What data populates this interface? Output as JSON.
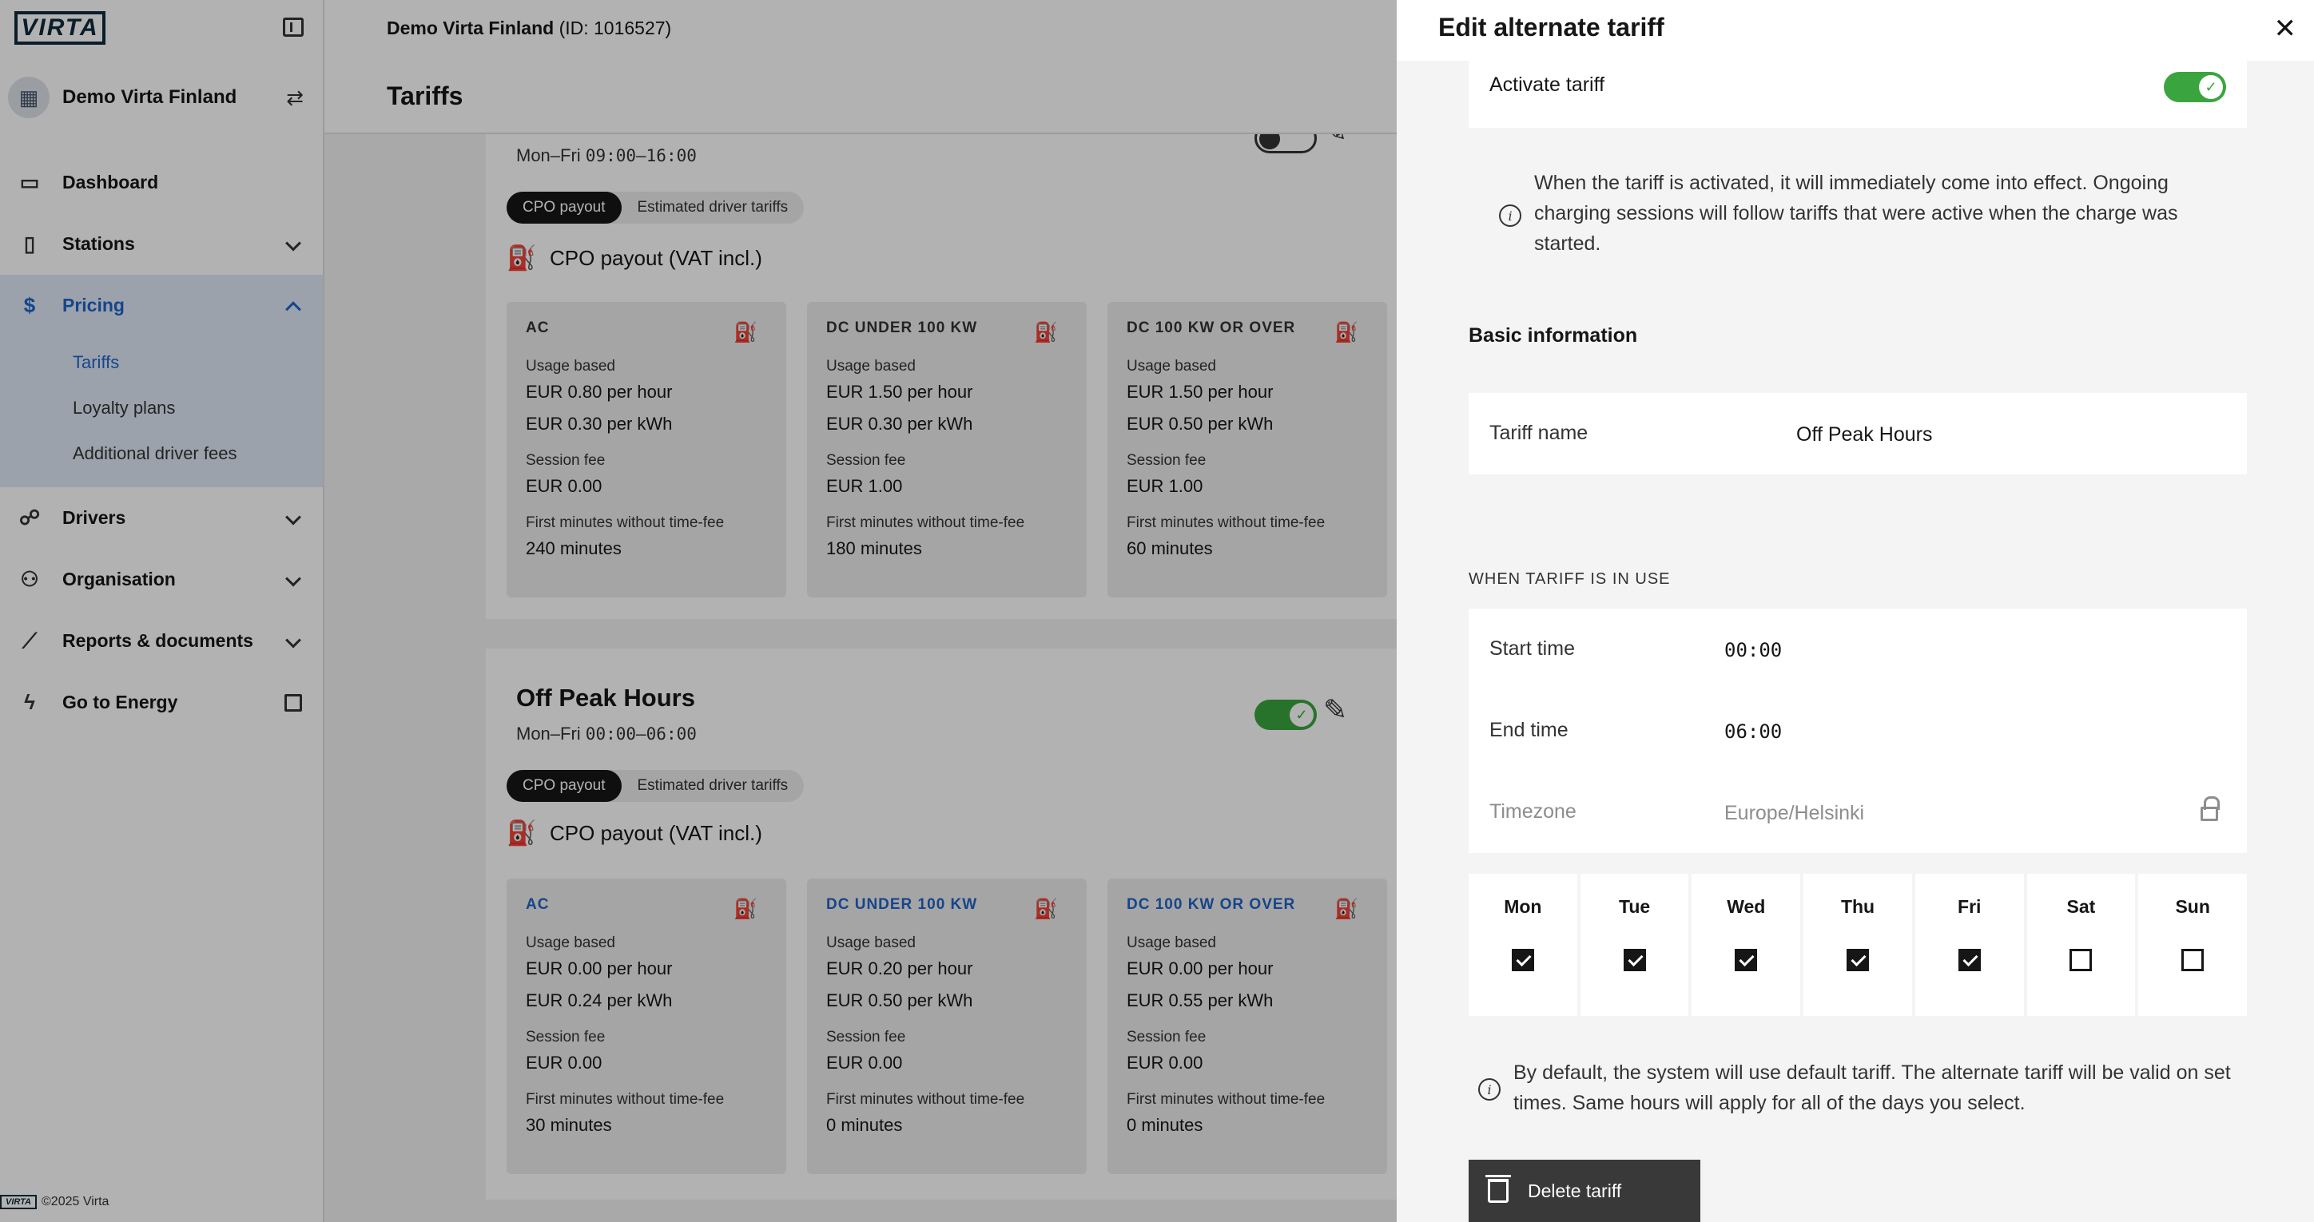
{
  "sidebar": {
    "logo": "VIRTA",
    "org_name": "Demo Virta Finland",
    "nav": [
      {
        "label": "Dashboard"
      },
      {
        "label": "Stations"
      },
      {
        "label": "Pricing"
      },
      {
        "label": "Drivers"
      },
      {
        "label": "Organisation"
      },
      {
        "label": "Reports & documents"
      },
      {
        "label": "Go to Energy"
      }
    ],
    "pricing_sub": [
      {
        "label": "Tariffs"
      },
      {
        "label": "Loyalty plans"
      },
      {
        "label": "Additional driver fees"
      }
    ],
    "footer": "©2025 Virta"
  },
  "header": {
    "org_name": "Demo Virta Finland",
    "org_id": "(ID: 1016527)",
    "page_title": "Tariffs"
  },
  "tariffs": [
    {
      "name": "",
      "days": "Mon–Fri ",
      "hours": "09:00–16:00",
      "active": false,
      "chips": [
        "CPO payout",
        "Estimated driver tariffs"
      ],
      "section_title": "CPO payout (VAT incl.)",
      "connectors": [
        {
          "title": "AC",
          "usage_label": "Usage based",
          "rate_hour": "EUR 0.80 per hour",
          "rate_kwh": "EUR 0.30 per kWh",
          "session_label": "Session fee",
          "session_fee": "EUR 0.00",
          "free_label": "First minutes without time-fee",
          "free_minutes": "240 minutes"
        },
        {
          "title": "DC UNDER 100 KW",
          "usage_label": "Usage based",
          "rate_hour": "EUR 1.50 per hour",
          "rate_kwh": "EUR 0.30 per kWh",
          "session_label": "Session fee",
          "session_fee": "EUR 1.00",
          "free_label": "First minutes without time-fee",
          "free_minutes": "180 minutes"
        },
        {
          "title": "DC 100 KW OR OVER",
          "usage_label": "Usage based",
          "rate_hour": "EUR 1.50 per hour",
          "rate_kwh": "EUR 0.50 per kWh",
          "session_label": "Session fee",
          "session_fee": "EUR 1.00",
          "free_label": "First minutes without time-fee",
          "free_minutes": "60 minutes"
        }
      ]
    },
    {
      "name": "Off Peak Hours",
      "days": "Mon–Fri ",
      "hours": "00:00–06:00",
      "active": true,
      "chips": [
        "CPO payout",
        "Estimated driver tariffs"
      ],
      "section_title": "CPO payout (VAT incl.)",
      "connectors": [
        {
          "title": "AC",
          "usage_label": "Usage based",
          "rate_hour": "EUR 0.00 per hour",
          "rate_kwh": "EUR 0.24 per kWh",
          "session_label": "Session fee",
          "session_fee": "EUR 0.00",
          "free_label": "First minutes without time-fee",
          "free_minutes": "30 minutes"
        },
        {
          "title": "DC UNDER 100 KW",
          "usage_label": "Usage based",
          "rate_hour": "EUR 0.20 per hour",
          "rate_kwh": "EUR 0.50 per kWh",
          "session_label": "Session fee",
          "session_fee": "EUR 0.00",
          "free_label": "First minutes without time-fee",
          "free_minutes": "0 minutes"
        },
        {
          "title": "DC 100 KW OR OVER",
          "usage_label": "Usage based",
          "rate_hour": "EUR 0.00 per hour",
          "rate_kwh": "EUR 0.55 per kWh",
          "session_label": "Session fee",
          "session_fee": "EUR 0.00",
          "free_label": "First minutes without time-fee",
          "free_minutes": "0 minutes"
        }
      ]
    }
  ],
  "drawer": {
    "title": "Edit alternate tariff",
    "activate_label": "Activate tariff",
    "activate_on": true,
    "activate_info": "When the tariff is activated, it will immediately come into effect. Ongoing charging sessions will follow tariffs that were active when the charge was started.",
    "basic_info_title": "Basic information",
    "tariff_name_label": "Tariff name",
    "tariff_name_value": "Off Peak Hours",
    "when_caption": "WHEN TARIFF IS IN USE",
    "start_label": "Start time",
    "start_value": "00:00",
    "end_label": "End time",
    "end_value": "06:00",
    "timezone_label": "Timezone",
    "timezone_value": "Europe/Helsinki",
    "days": [
      {
        "label": "Mon",
        "checked": true
      },
      {
        "label": "Tue",
        "checked": true
      },
      {
        "label": "Wed",
        "checked": true
      },
      {
        "label": "Thu",
        "checked": true
      },
      {
        "label": "Fri",
        "checked": true
      },
      {
        "label": "Sat",
        "checked": false
      },
      {
        "label": "Sun",
        "checked": false
      }
    ],
    "default_info": "By default, the system will use default tariff. The alternate tariff will be valid on set times. Same hours will apply for all of the days you select.",
    "delete_label": "Delete tariff"
  },
  "colors": {
    "accent": "#1f63c7",
    "toggle_on": "#3aa53e",
    "active_nav_bg": "#dfe9f7"
  },
  "icons": {
    "logo": "virta-logo",
    "collapse": "sidebar-collapse-icon",
    "org": "building-icon",
    "switch_org": "switch-arrows-icon",
    "dashboard": "presentation-chart-icon",
    "stations": "charging-station-icon",
    "pricing": "currency-circle-icon",
    "drivers": "person-walking-icon",
    "organisation": "people-network-icon",
    "reports": "line-chart-icon",
    "energy": "lightning-icon",
    "external": "external-link-icon",
    "edit": "pencil-icon",
    "cpo": "charger-price-icon",
    "info": "info-icon",
    "lock": "lock-icon",
    "close": "close-icon",
    "delete": "trash-icon"
  }
}
